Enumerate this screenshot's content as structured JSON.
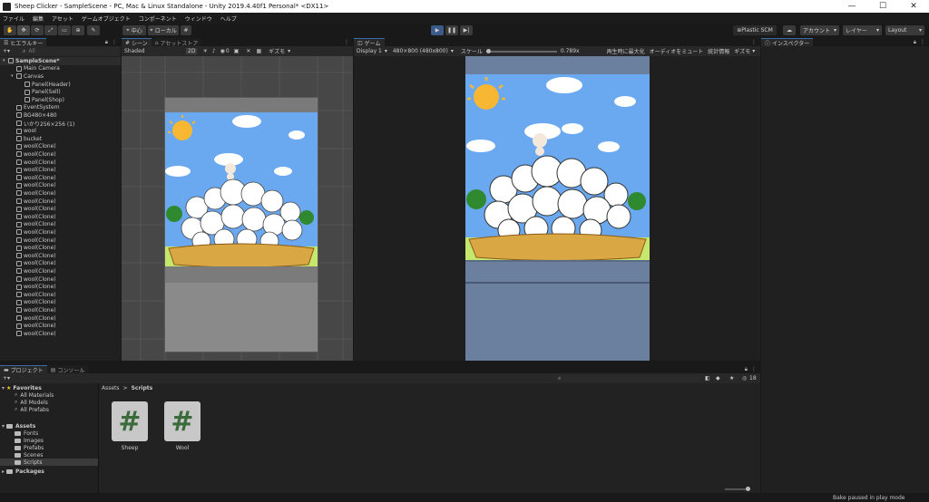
{
  "window": {
    "title": "Sheep Clicker - SampleScene - PC, Mac & Linux Standalone - Unity 2019.4.40f1 Personal* <DX11>",
    "controls": [
      "—",
      "☐",
      "✕"
    ]
  },
  "menu": [
    "ファイル",
    "編集",
    "アセット",
    "ゲームオブジェクト",
    "コンポーネント",
    "ウィンドウ",
    "ヘルプ"
  ],
  "toolbar": {
    "pivot_label": "中心",
    "space_label": "ローカル",
    "plastic_label": "⊕Plastic SCM",
    "account_label": "アカウント",
    "layers_label": "レイヤー",
    "layout_label": "Layout"
  },
  "hierarchy": {
    "tab_label": "ヒエラルキー",
    "search_placeholder": "All",
    "items": [
      {
        "label": "SampleScene*",
        "depth": 0,
        "kind": "scene"
      },
      {
        "label": "Main Camera",
        "depth": 1,
        "kind": "object"
      },
      {
        "label": "Canvas",
        "depth": 1,
        "kind": "parent"
      },
      {
        "label": "Panel(Header)",
        "depth": 2,
        "kind": "object"
      },
      {
        "label": "Panel(Sell)",
        "depth": 2,
        "kind": "object"
      },
      {
        "label": "Panel(Shop)",
        "depth": 2,
        "kind": "object"
      },
      {
        "label": "EventSystem",
        "depth": 1,
        "kind": "object"
      },
      {
        "label": "BG480×480",
        "depth": 1,
        "kind": "object"
      },
      {
        "label": "いかり256×256 (1)",
        "depth": 1,
        "kind": "object"
      },
      {
        "label": "wool",
        "depth": 1,
        "kind": "object"
      },
      {
        "label": "bucket",
        "depth": 1,
        "kind": "object"
      },
      {
        "label": "wool(Clone)",
        "depth": 1,
        "kind": "object"
      },
      {
        "label": "wool(Clone)",
        "depth": 1,
        "kind": "object"
      },
      {
        "label": "wool(Clone)",
        "depth": 1,
        "kind": "object"
      },
      {
        "label": "wool(Clone)",
        "depth": 1,
        "kind": "object"
      },
      {
        "label": "wool(Clone)",
        "depth": 1,
        "kind": "object"
      },
      {
        "label": "wool(Clone)",
        "depth": 1,
        "kind": "object"
      },
      {
        "label": "wool(Clone)",
        "depth": 1,
        "kind": "object"
      },
      {
        "label": "wool(Clone)",
        "depth": 1,
        "kind": "object"
      },
      {
        "label": "wool(Clone)",
        "depth": 1,
        "kind": "object"
      },
      {
        "label": "wool(Clone)",
        "depth": 1,
        "kind": "object"
      },
      {
        "label": "wool(Clone)",
        "depth": 1,
        "kind": "object"
      },
      {
        "label": "wool(Clone)",
        "depth": 1,
        "kind": "object"
      },
      {
        "label": "wool(Clone)",
        "depth": 1,
        "kind": "object"
      },
      {
        "label": "wool(Clone)",
        "depth": 1,
        "kind": "object"
      },
      {
        "label": "wool(Clone)",
        "depth": 1,
        "kind": "object"
      },
      {
        "label": "wool(Clone)",
        "depth": 1,
        "kind": "object"
      },
      {
        "label": "wool(Clone)",
        "depth": 1,
        "kind": "object"
      },
      {
        "label": "wool(Clone)",
        "depth": 1,
        "kind": "object"
      },
      {
        "label": "wool(Clone)",
        "depth": 1,
        "kind": "object"
      },
      {
        "label": "wool(Clone)",
        "depth": 1,
        "kind": "object"
      },
      {
        "label": "wool(Clone)",
        "depth": 1,
        "kind": "object"
      },
      {
        "label": "wool(Clone)",
        "depth": 1,
        "kind": "object"
      },
      {
        "label": "wool(Clone)",
        "depth": 1,
        "kind": "object"
      },
      {
        "label": "wool(Clone)",
        "depth": 1,
        "kind": "object"
      },
      {
        "label": "wool(Clone)",
        "depth": 1,
        "kind": "object"
      }
    ]
  },
  "scene": {
    "tab_label": "シーン",
    "store_tab_label": "アセットストア",
    "shading_mode": "Shaded",
    "mode_2d": "2D",
    "gizmos_label": "ギズモ",
    "hidden_count": "0"
  },
  "game": {
    "tab_label": "ゲーム",
    "display_label": "Display 1",
    "resolution_label": "480×800 (480x800)",
    "scale_label": "スケール",
    "scale_value": "0.789x",
    "maximize_label": "再生時に最大化",
    "mute_label": "オーディオをミュート",
    "stats_label": "統計情報",
    "gizmos_label": "ギズモ"
  },
  "inspector": {
    "tab_label": "インスペクター"
  },
  "project": {
    "tab_label": "プロジェクト",
    "console_tab_label": "コンソール",
    "breadcrumb_root": "Assets",
    "breadcrumb_separator": ">",
    "breadcrumb_current": "Scripts",
    "hidden_count": "18",
    "favorites_label": "Favorites",
    "favorites": [
      "All Materials",
      "All Models",
      "All Prefabs"
    ],
    "assets_label": "Assets",
    "folders": [
      "Fonts",
      "Images",
      "Prefabs",
      "Scenes",
      "Scripts"
    ],
    "packages_label": "Packages",
    "scripts": [
      {
        "name": "Sheep"
      },
      {
        "name": "Wool"
      }
    ]
  },
  "status": {
    "message": "Bake paused in play mode"
  },
  "colors": {
    "accent": "#3d6aa8",
    "play_active": "#3a5a88",
    "sky": "#6aa8f0",
    "grass": "#c5e86c",
    "game_bg": "#6b7f9e",
    "scene_bg": "#808080"
  }
}
